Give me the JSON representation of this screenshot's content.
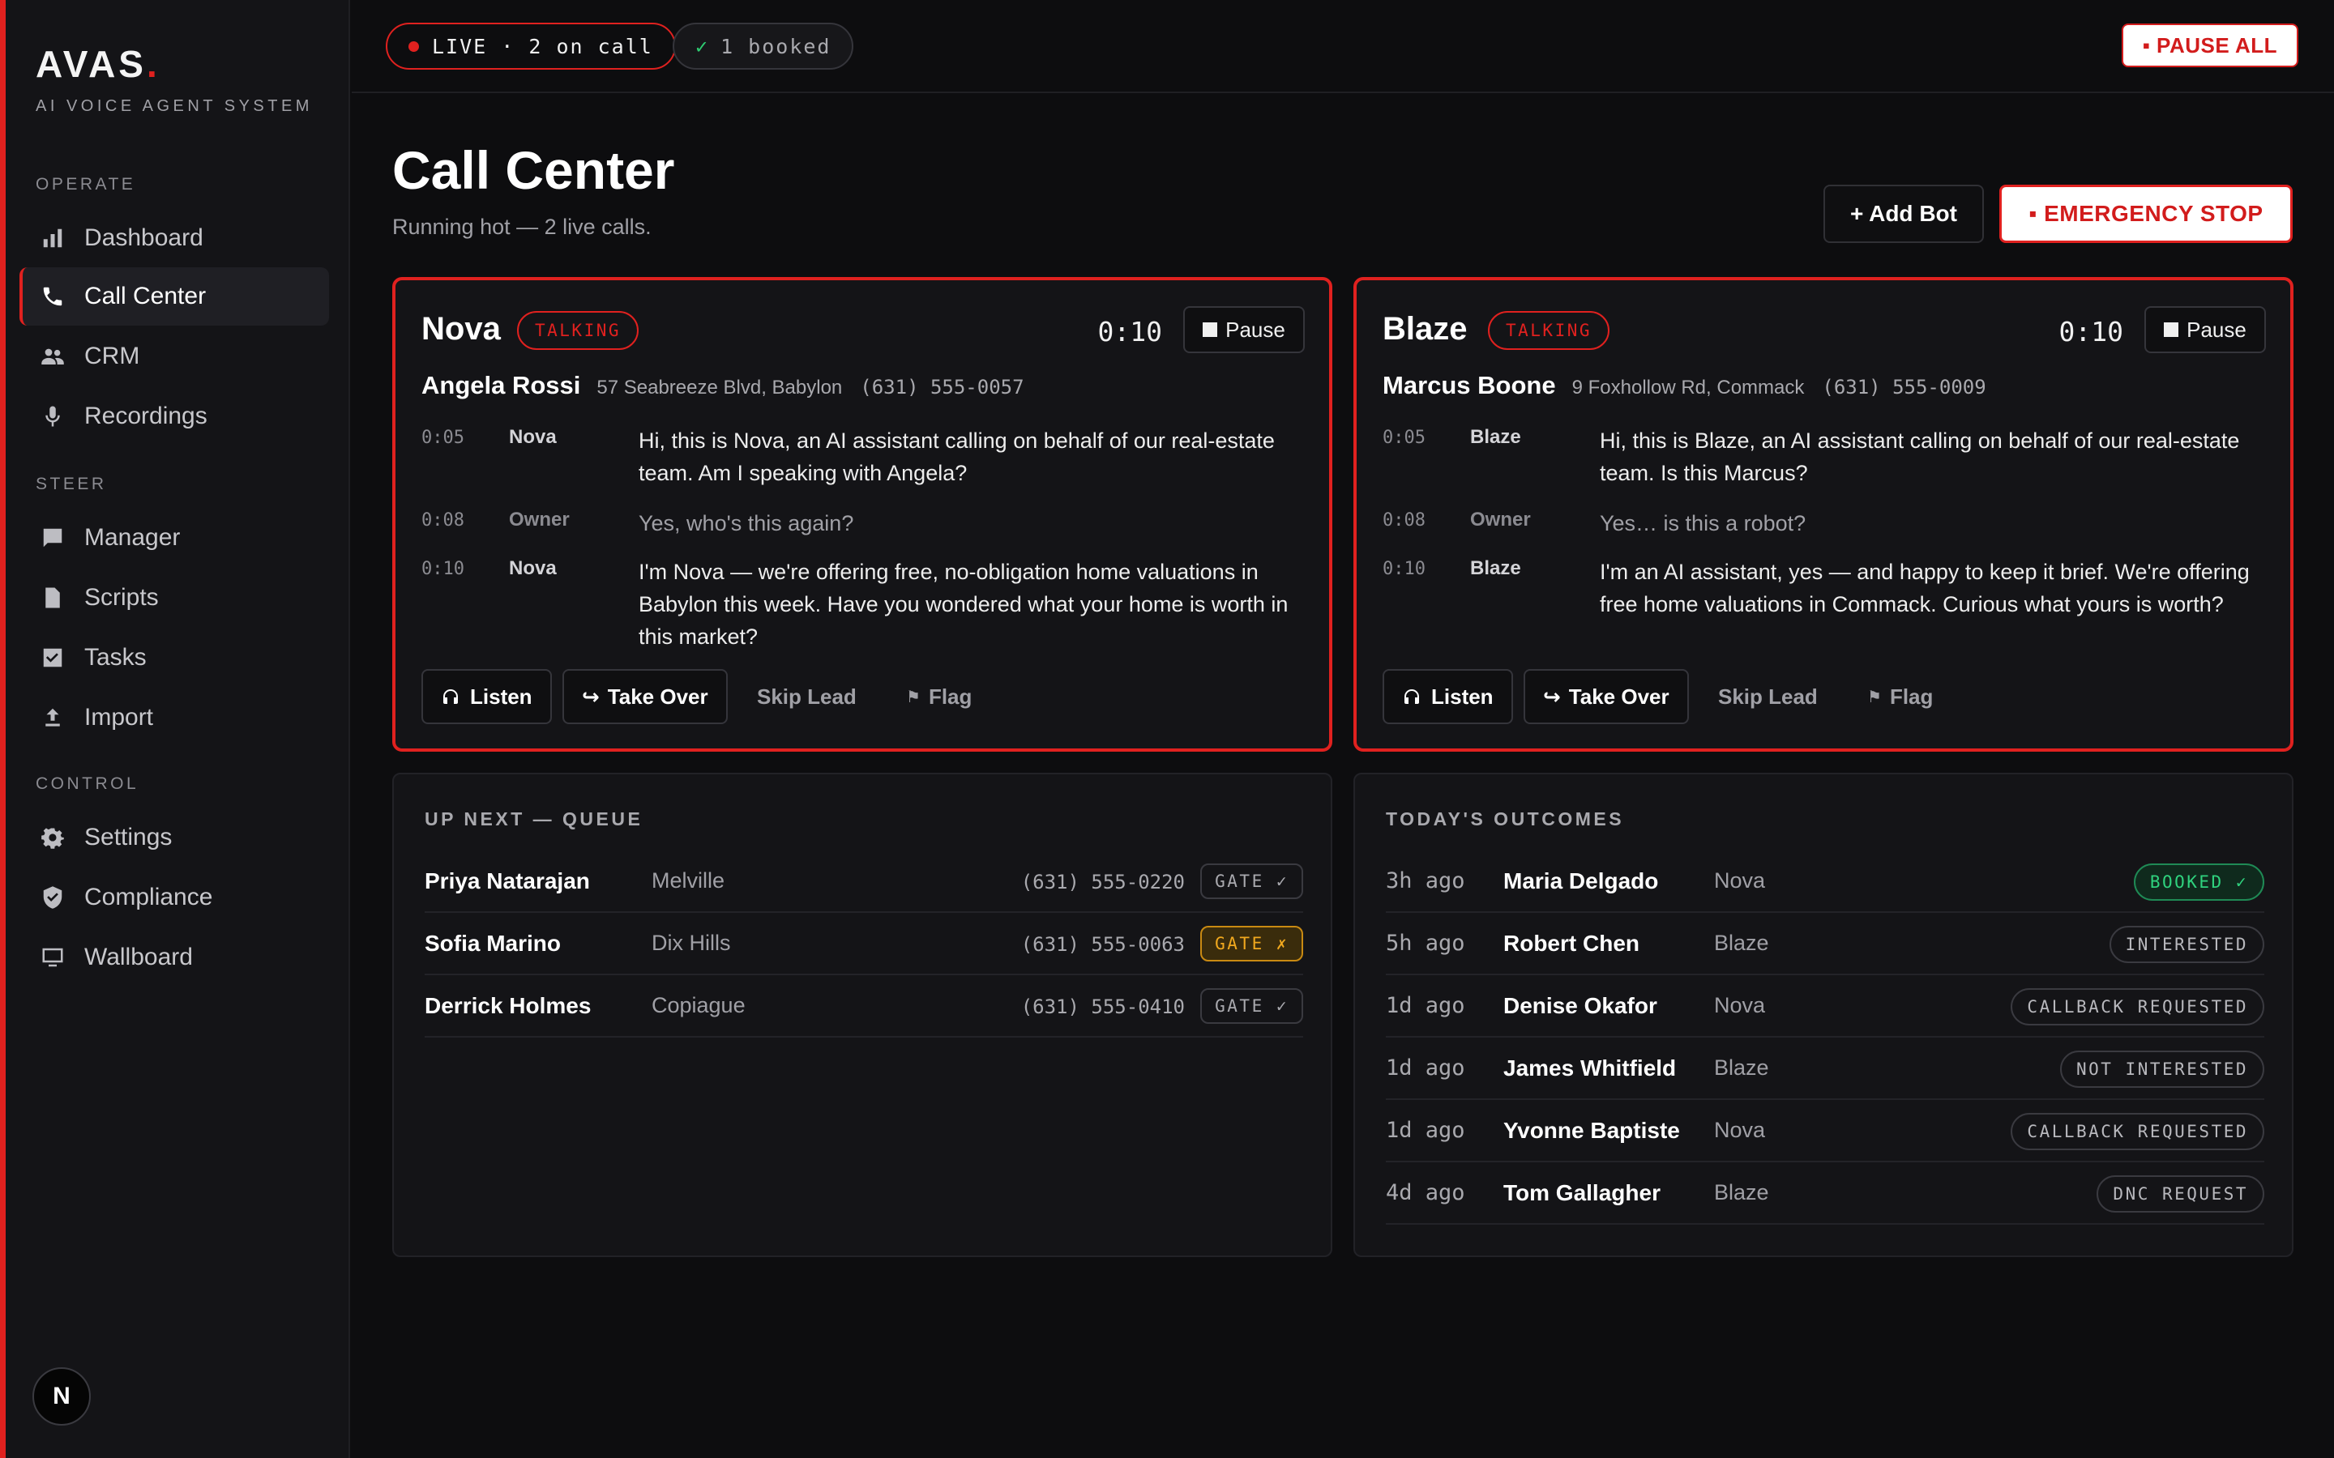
{
  "brand": {
    "name": "AVAS",
    "dot": ".",
    "tagline": "AI VOICE AGENT SYSTEM",
    "accent": "#e0211f"
  },
  "sidebar": {
    "sections": [
      {
        "label": "OPERATE",
        "items": [
          {
            "label": "Dashboard",
            "icon": "bar-chart-icon"
          },
          {
            "label": "Call Center",
            "icon": "phone-icon",
            "active": true
          },
          {
            "label": "CRM",
            "icon": "people-icon"
          },
          {
            "label": "Recordings",
            "icon": "microphone-icon"
          }
        ]
      },
      {
        "label": "STEER",
        "items": [
          {
            "label": "Manager",
            "icon": "chat-icon"
          },
          {
            "label": "Scripts",
            "icon": "document-icon"
          },
          {
            "label": "Tasks",
            "icon": "checkbox-icon"
          },
          {
            "label": "Import",
            "icon": "upload-icon"
          }
        ]
      },
      {
        "label": "CONTROL",
        "items": [
          {
            "label": "Settings",
            "icon": "gear-icon"
          },
          {
            "label": "Compliance",
            "icon": "shield-icon"
          },
          {
            "label": "Wallboard",
            "icon": "monitor-icon"
          }
        ]
      }
    ],
    "avatar": "N"
  },
  "topbar": {
    "live": "LIVE · 2 on call",
    "booked_check": "✓",
    "booked": "1 booked",
    "pause_all": "▪ PAUSE ALL"
  },
  "header": {
    "title": "Call Center",
    "subtitle": "Running hot — 2 live calls.",
    "add_bot": "+ Add Bot",
    "emergency_stop": "▪ EMERGENCY STOP"
  },
  "calls": [
    {
      "bot": "Nova",
      "status": "TALKING",
      "timer": "0:10",
      "pause": "Pause",
      "lead": {
        "name": "Angela Rossi",
        "address": "57 Seabreeze Blvd, Babylon",
        "phone": "(631) 555-0057"
      },
      "transcript": [
        {
          "time": "0:05",
          "speaker": "Nova",
          "text": "Hi, this is Nova, an AI assistant calling on behalf of our real-estate team. Am I speaking with Angela?"
        },
        {
          "time": "0:08",
          "speaker": "Owner",
          "text": "Yes, who's this again?"
        },
        {
          "time": "0:10",
          "speaker": "Nova",
          "text": "I'm Nova — we're offering free, no-obligation home valuations in Babylon this week. Have you wondered what your home is worth in this market?"
        }
      ],
      "actions": {
        "listen": "Listen",
        "take_over": "Take Over",
        "skip": "Skip Lead",
        "flag": "Flag"
      }
    },
    {
      "bot": "Blaze",
      "status": "TALKING",
      "timer": "0:10",
      "pause": "Pause",
      "lead": {
        "name": "Marcus Boone",
        "address": "9 Foxhollow Rd, Commack",
        "phone": "(631) 555-0009"
      },
      "transcript": [
        {
          "time": "0:05",
          "speaker": "Blaze",
          "text": "Hi, this is Blaze, an AI assistant calling on behalf of our real-estate team. Is this Marcus?"
        },
        {
          "time": "0:08",
          "speaker": "Owner",
          "text": "Yes… is this a robot?"
        },
        {
          "time": "0:10",
          "speaker": "Blaze",
          "text": "I'm an AI assistant, yes — and happy to keep it brief. We're offering free home valuations in Commack. Curious what yours is worth?"
        }
      ],
      "actions": {
        "listen": "Listen",
        "take_over": "Take Over",
        "skip": "Skip Lead",
        "flag": "Flag"
      }
    }
  ],
  "queue": {
    "title": "UP NEXT — QUEUE",
    "rows": [
      {
        "name": "Priya Natarajan",
        "town": "Melville",
        "phone": "(631) 555-0220",
        "gate": "GATE ✓",
        "gate_status": "pass"
      },
      {
        "name": "Sofia Marino",
        "town": "Dix Hills",
        "phone": "(631) 555-0063",
        "gate": "GATE ✗",
        "gate_status": "fail"
      },
      {
        "name": "Derrick Holmes",
        "town": "Copiague",
        "phone": "(631) 555-0410",
        "gate": "GATE ✓",
        "gate_status": "pass"
      }
    ]
  },
  "outcomes": {
    "title": "TODAY'S OUTCOMES",
    "rows": [
      {
        "time": "3h ago",
        "name": "Maria Delgado",
        "bot": "Nova",
        "outcome": "BOOKED ✓",
        "kind": "booked"
      },
      {
        "time": "5h ago",
        "name": "Robert Chen",
        "bot": "Blaze",
        "outcome": "INTERESTED",
        "kind": "neutral"
      },
      {
        "time": "1d ago",
        "name": "Denise Okafor",
        "bot": "Nova",
        "outcome": "CALLBACK REQUESTED",
        "kind": "neutral"
      },
      {
        "time": "1d ago",
        "name": "James Whitfield",
        "bot": "Blaze",
        "outcome": "NOT INTERESTED",
        "kind": "neutral"
      },
      {
        "time": "1d ago",
        "name": "Yvonne Baptiste",
        "bot": "Nova",
        "outcome": "CALLBACK REQUESTED",
        "kind": "neutral"
      },
      {
        "time": "4d ago",
        "name": "Tom Gallagher",
        "bot": "Blaze",
        "outcome": "DNC REQUEST",
        "kind": "neutral"
      }
    ]
  },
  "colors": {
    "accent_red": "#e0211f",
    "success_green": "#2fd27e",
    "warning_amber": "#f0a81e",
    "background": "#0d0d0f",
    "panel": "#141417"
  }
}
